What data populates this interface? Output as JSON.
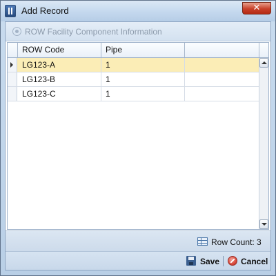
{
  "window": {
    "title": "Add Record",
    "close_label": "✕"
  },
  "section": {
    "title": "ROW Facility Component Information"
  },
  "grid": {
    "columns": [
      "ROW Code",
      "Pipe",
      ""
    ],
    "rows": [
      {
        "row_code": "LG123-A",
        "pipe": "1",
        "selected": true
      },
      {
        "row_code": "LG123-B",
        "pipe": "1",
        "selected": false
      },
      {
        "row_code": "LG123-C",
        "pipe": "1",
        "selected": false
      }
    ]
  },
  "status": {
    "row_count_label": "Row Count:",
    "row_count_value": "3"
  },
  "footer": {
    "save_label": "Save",
    "cancel_label": "Cancel"
  },
  "colors": {
    "selected_row": "#fbedb6",
    "window_frame": "#c9dcef",
    "close_button": "#c8412a"
  }
}
